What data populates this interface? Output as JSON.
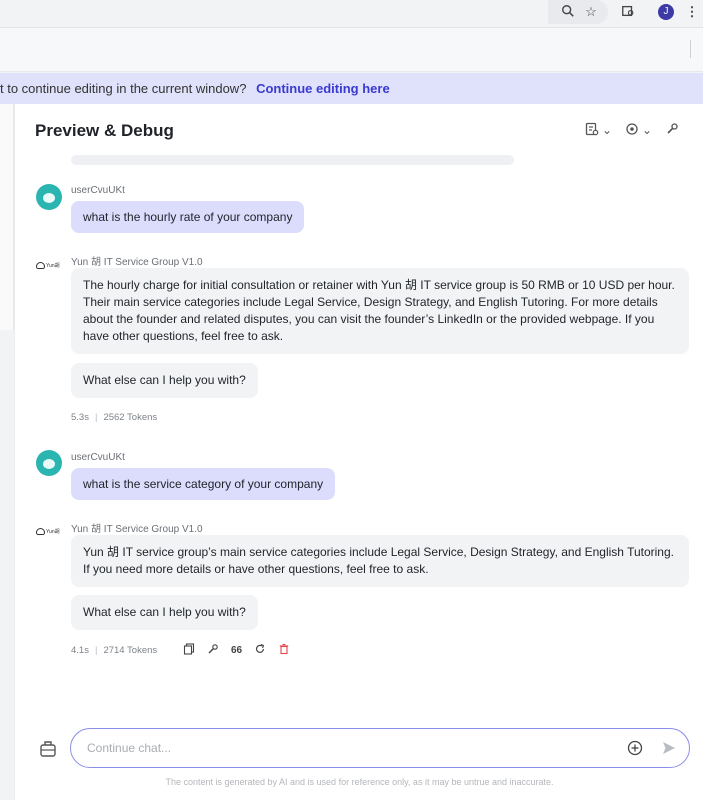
{
  "browser": {
    "icons": [
      "zoom-icon",
      "star-icon",
      "reading-list-icon",
      "profile-avatar",
      "more-menu-icon"
    ],
    "profile_initial": "J"
  },
  "banner": {
    "text": "t to continue editing in the current window?",
    "link": "Continue editing here"
  },
  "panel": {
    "title": "Preview & Debug",
    "header_icons": [
      "memo-icon",
      "settings-icon",
      "debug-icon"
    ]
  },
  "conversation": [
    {
      "user": {
        "name": "userCvuUKt",
        "message": "what is the hourly rate of your company"
      },
      "bot": {
        "name": "Yun 胡 IT Service Group V1.0",
        "logo_text": "Yun胡",
        "answer": "The hourly charge for initial consultation or retainer with Yun 胡 IT service group is 50 RMB or 10 USD per hour. Their main service categories include Legal Service, Design Strategy, and English Tutoring. For more details about the founder and related disputes, you can visit the founder’s LinkedIn or the provided webpage. If you have other questions, feel free to ask.",
        "followup": "What else can I help you with?",
        "time": "5.3s",
        "tokens": "2562 Tokens"
      }
    },
    {
      "user": {
        "name": "userCvuUKt",
        "message": "what is the service category of your company"
      },
      "bot": {
        "name": "Yun 胡 IT Service Group V1.0",
        "logo_text": "Yun胡",
        "answer": "Yun 胡 IT service group’s main service categories include Legal Service, Design Strategy, and English Tutoring. If you need more details or have other questions, feel free to ask.",
        "followup": "What else can I help you with?",
        "time": "4.1s",
        "tokens": "2714 Tokens",
        "quote_label": "66"
      }
    }
  ],
  "input": {
    "placeholder": "Continue chat..."
  },
  "disclaimer": "The content is generated by AI and is used for reference only, as it may be untrue and inaccurate.",
  "colors": {
    "accent": "#3a3ad0",
    "user_bubble": "#dcdcfd",
    "banner_bg": "#e0e1fb",
    "avatar": "#2bb5b0",
    "delete": "#e5484d"
  }
}
